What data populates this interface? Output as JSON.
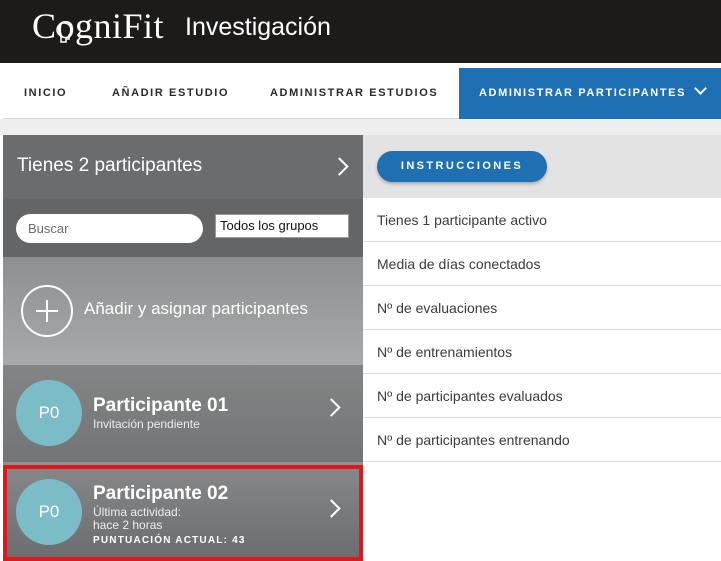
{
  "header": {
    "logo": "CogniFit",
    "subtitle": "Investigación"
  },
  "nav": {
    "items": [
      {
        "label": "INICIO"
      },
      {
        "label": "AÑADIR ESTUDIO"
      },
      {
        "label": "ADMINISTRAR ESTUDIOS"
      },
      {
        "label": "ADMINISTRAR PARTICIPANTES"
      }
    ],
    "active_index": 3,
    "active_color": "#1f6fb3"
  },
  "left_panel": {
    "title": "Tienes 2 participantes",
    "search": {
      "placeholder": "Buscar",
      "value": ""
    },
    "group_filter": "Todos los grupos",
    "add_label": "Añadir y asignar participantes",
    "participants": [
      {
        "initials": "P0",
        "name": "Participante 01",
        "line1": "Invitación pendiente"
      },
      {
        "initials": "P0",
        "name": "Participante 02",
        "line1": "Última actividad:",
        "line2": "hace 2 horas",
        "score": "PUNTUACIÓN ACTUAL: 43"
      }
    ],
    "highlight_color": "#e0181e",
    "avatar_color": "#7bbcc7"
  },
  "right_panel": {
    "button": "INSTRUCCIONES",
    "stats": [
      "Tienes 1 participante activo",
      "Media de días conectados",
      "Nº de evaluaciones",
      "Nº de entrenamientos",
      "Nº de participantes evaluados",
      "Nº de participantes entrenando"
    ]
  }
}
